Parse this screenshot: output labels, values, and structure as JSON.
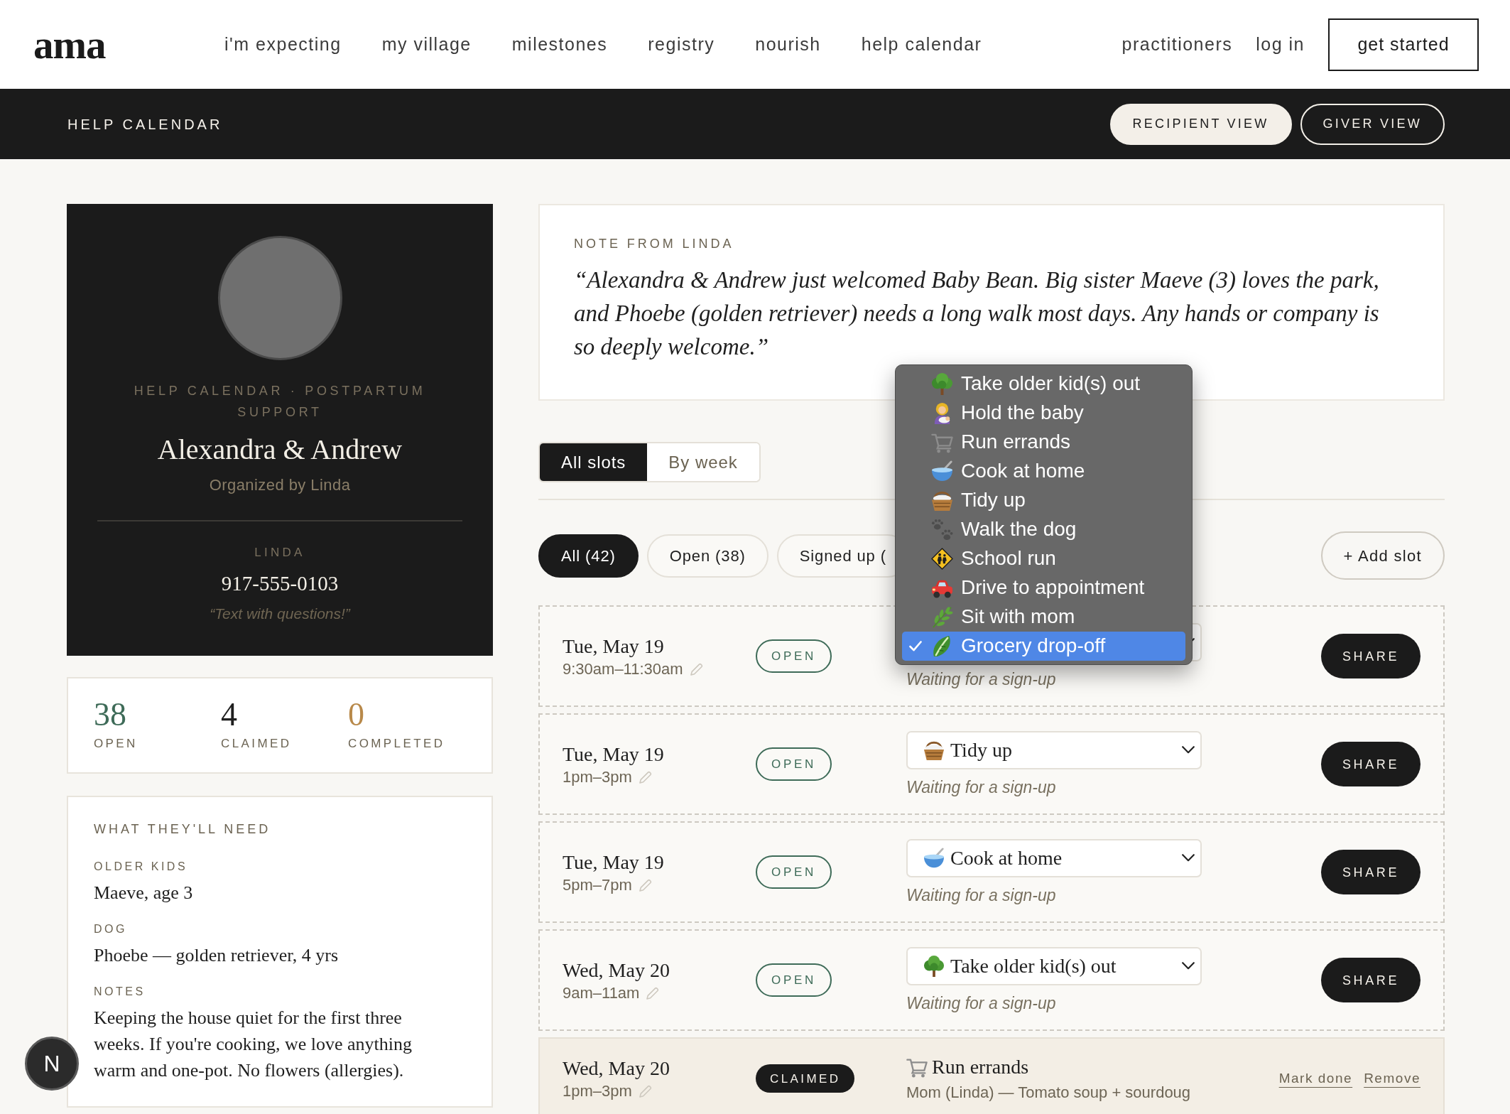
{
  "nav": {
    "logo": "ama",
    "links": [
      "i'm expecting",
      "my village",
      "milestones",
      "registry",
      "nourish",
      "help calendar"
    ],
    "secondary_links": [
      "practitioners",
      "log in"
    ],
    "cta": "get started"
  },
  "header_bar": {
    "title": "HELP CALENDAR",
    "views": [
      {
        "label": "RECIPIENT VIEW",
        "selected": true
      },
      {
        "label": "GIVER VIEW",
        "selected": false
      }
    ]
  },
  "profile": {
    "eyebrow": "HELP CALENDAR · POSTPARTUM SUPPORT",
    "names": "Alexandra & Andrew",
    "organizer": "Organized by Linda",
    "contact_name": "LINDA",
    "phone": "917-555-0103",
    "contact_note": "“Text with questions!”"
  },
  "stats": [
    {
      "value": "38",
      "label": "OPEN",
      "color": "#3e6b58"
    },
    {
      "value": "4",
      "label": "CLAIMED",
      "color": "#1f1f1f"
    },
    {
      "value": "0",
      "label": "COMPLETED",
      "color": "#b8894a"
    }
  ],
  "needs": {
    "title": "WHAT THEY'LL NEED",
    "sections": [
      {
        "label": "OLDER KIDS",
        "text": "Maeve, age 3"
      },
      {
        "label": "DOG",
        "text": "Phoebe — golden retriever, 4 yrs"
      },
      {
        "label": "NOTES",
        "text": "Keeping the house quiet for the first three weeks. If you're cooking, we love anything warm and one-pot. No flowers (allergies)."
      }
    ]
  },
  "note": {
    "title": "NOTE FROM LINDA",
    "text": "“Alexandra & Andrew just welcomed Baby Bean. Big sister Maeve (3) loves the park, and Phoebe (golden retriever) needs a long walk most days. Any hands or company is so deeply welcome.”"
  },
  "view_tabs": [
    {
      "label": "All slots",
      "selected": true
    },
    {
      "label": "By week",
      "selected": false
    }
  ],
  "filters": [
    {
      "label": "All (42)",
      "selected": true
    },
    {
      "label": "Open (38)",
      "selected": false
    },
    {
      "label": "Signed up (",
      "selected": false
    }
  ],
  "add_slot": "+ Add slot",
  "slots": [
    {
      "kind": "open",
      "date": "Tue, May 19",
      "time": "9:30am–11:30am",
      "badge": "OPEN",
      "task_menu": {
        "options": [
          {
            "label": "Take older kid(s) out",
            "kind": "tree",
            "selected": false
          },
          {
            "label": "Hold the baby",
            "kind": "caregiver",
            "selected": false
          },
          {
            "label": "Run errands",
            "kind": "cart",
            "selected": false
          },
          {
            "label": "Cook at home",
            "kind": "bowl",
            "selected": false
          },
          {
            "label": "Tidy up",
            "kind": "basket",
            "selected": false
          },
          {
            "label": "Walk the dog",
            "kind": "paws",
            "selected": false
          },
          {
            "label": "School run",
            "kind": "crossing",
            "selected": false
          },
          {
            "label": "Drive to appointment",
            "kind": "car",
            "selected": false
          },
          {
            "label": "Sit with mom",
            "kind": "herb",
            "selected": false
          },
          {
            "label": "Grocery drop-off",
            "kind": "greens",
            "selected": true
          }
        ]
      },
      "status_text": "Waiting for a sign-up",
      "action": "SHARE"
    },
    {
      "kind": "open",
      "date": "Tue, May 19",
      "time": "1pm–3pm",
      "badge": "OPEN",
      "task": {
        "label": "Tidy up",
        "kind": "basket"
      },
      "status_text": "Waiting for a sign-up",
      "action": "SHARE"
    },
    {
      "kind": "open",
      "date": "Tue, May 19",
      "time": "5pm–7pm",
      "badge": "OPEN",
      "task": {
        "label": "Cook at home",
        "kind": "bowl"
      },
      "status_text": "Waiting for a sign-up",
      "action": "SHARE"
    },
    {
      "kind": "open",
      "date": "Wed, May 20",
      "time": "9am–11am",
      "badge": "OPEN",
      "task": {
        "label": "Take older kid(s) out",
        "kind": "tree"
      },
      "status_text": "Waiting for a sign-up",
      "action": "SHARE"
    },
    {
      "kind": "claimed",
      "date": "Wed, May 20",
      "time": "1pm–3pm",
      "badge": "CLAIMED",
      "task": {
        "label": "Run errands",
        "kind": "cart"
      },
      "status_text": "Mom (Linda) — Tomato soup + sourdoug",
      "actions": [
        "Mark done",
        "Remove"
      ]
    }
  ],
  "dev_badge": {
    "label": "N"
  }
}
